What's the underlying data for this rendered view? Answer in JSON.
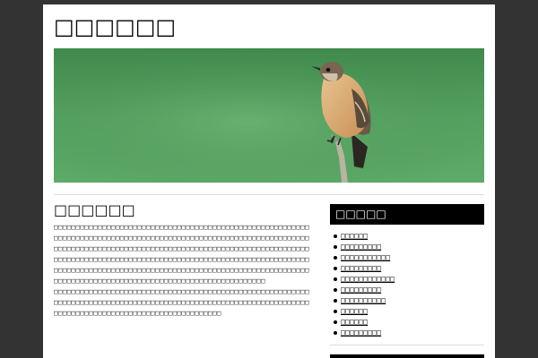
{
  "site": {
    "title": "□□□□□□",
    "banner_alt": "bird-on-stick-banner"
  },
  "post": {
    "title": "□□□□□□",
    "paragraphs": [
      "□□□□□□□□□□□□□□□□□□□□□□□□□□□□□□□□□□□□□□□□□□□□□□□□□□□□□□□□□□□□□□□□□□□□□□□□□□□□□□□□□□□□□□□□□□□□□□□□□□□□□□□□□□□□□□□□□□□□□□□□□□□□□□□□□□□□□□□□□□□□□□□□□□□□□□□□□□□□□□□□□□□□□□□□□□□□□□□□□□□□□□□□□□□□□□□□□□□□□□□□□□□□□□□□□□□□□□□□□□□□□□□□□□□□□□□□□□□□□□□□□□□□□□□□□□□□□□□□□□□□□□□□□□□□□□□□□□□□□□□□□□□□□□□□□□□□□□□□□□□□□□□□□□□□□□□□□□□□□□□□□□□□□□□□□□□□□□□□□□",
      "□□□□□□□□□□□□□□□□□□□□□□□□□□□□□□□□□□□□□□□□□□□□□□□□□□□□□□□□□□□□□□□□□□□□□□□□□□□□□□□□□□□□□□□□□□□□□□□□□□□□□□□□□□□□□□□□□□□□□□□□□□□□□□□□□□□□□□□□□□□□□□□□□□□□□□□□□□"
    ]
  },
  "sidebar": {
    "widget1_title": "□□□□□",
    "links": [
      "□□□□□□",
      "□□□□□□□□□",
      "□□□□□□□□□□□",
      "□□□□□□□□□",
      "□□□□□□□□□□□□",
      "□□□□□□□□□",
      "□□□□□□□□□□",
      "□□□□□□",
      "□□□□□□",
      "□□□□□□□□□"
    ],
    "widget2_title": "□□□□"
  },
  "colors": {
    "background": "#333333",
    "page": "#ffffff",
    "widget_header": "#000000",
    "banner_green": "#4e9a5a"
  }
}
